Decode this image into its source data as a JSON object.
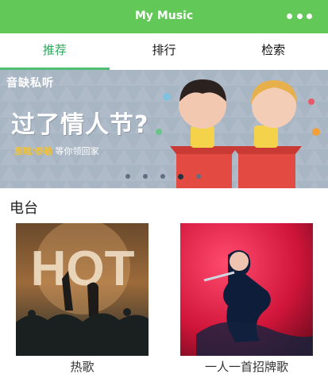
{
  "app": {
    "title": "My Music"
  },
  "tabs": [
    {
      "label": "推荐",
      "active": true
    },
    {
      "label": "排行",
      "active": false
    },
    {
      "label": "检索",
      "active": false
    }
  ],
  "banner": {
    "brand": "音缺私听",
    "headline": "过了情人节?",
    "sub_highlight": "鹿晗/泰勒",
    "sub_text": "等你领回家",
    "slides": 5,
    "active_slide": 4
  },
  "section": {
    "title": "电台"
  },
  "cards": [
    {
      "label": "热歌",
      "cover_text": "HOT"
    },
    {
      "label": "一人一首招牌歌"
    }
  ],
  "colors": {
    "accent": "#62c857",
    "active_tab": "#2fa65e"
  },
  "icons": {
    "menu": "more-dots-icon"
  }
}
